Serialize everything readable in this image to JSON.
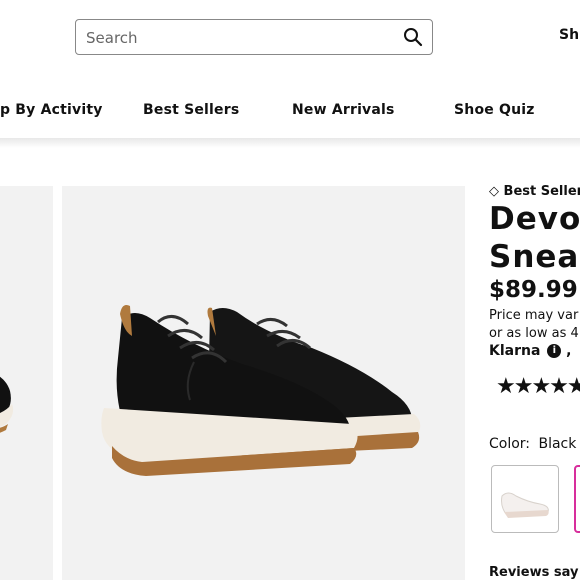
{
  "header": {
    "search_placeholder": "Search",
    "shop_link": "Shi"
  },
  "nav": {
    "items": [
      {
        "label": "p By Activity"
      },
      {
        "label": "Best Sellers"
      },
      {
        "label": "New Arrivals"
      },
      {
        "label": "Shoe Quiz"
      }
    ]
  },
  "product": {
    "badge": "Best Seller",
    "title_line1": "Devot",
    "title_line2": "Sneak",
    "price": "$89.99",
    "price_note_line1": "Price may var",
    "price_note_line2": "or as low as 4",
    "klarna_label": "Klarna",
    "klarna_sep": ",",
    "rating_stars": "★★★★★",
    "color_label": "Color:",
    "color_value": "Black",
    "reviews_label": "Reviews say t"
  },
  "colors": {
    "accent_swatch_border": "#d72e9c",
    "shoe_upper": "#111111",
    "sole": "#f1ebe1",
    "outsole": "#b07a3e"
  }
}
